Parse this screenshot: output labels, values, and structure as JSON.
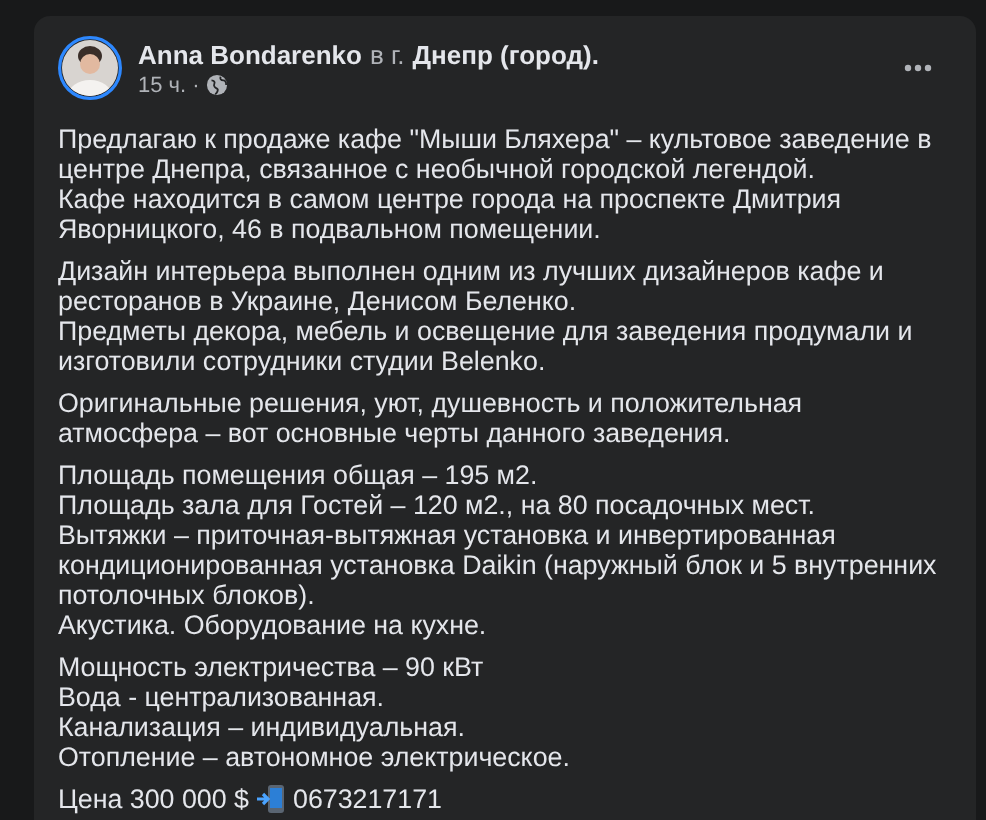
{
  "post": {
    "author": "Anna Bondarenko",
    "location_prefix": "в г.",
    "location": "Днепр (город).",
    "time": "15 ч.",
    "separator": "·",
    "paragraphs": [
      {
        "kind": "text",
        "lines": [
          "Предлагаю к продаже кафе \"Мыши Бляхера\" – культовое заведение в центре Днепра, связанное с необычной городской легендой.",
          "Кафе находится в самом центре города на проспекте Дмитрия Яворницкого, 46 в подвальном помещении."
        ]
      },
      {
        "kind": "text",
        "lines": [
          "Дизайн интерьера выполнен одним из лучших дизайнеров кафе и ресторанов в Украине, Денисом Беленко.",
          "Предметы декора, мебель и освещение для заведения продумали и изготовили сотрудники студии Belenko."
        ]
      },
      {
        "kind": "text",
        "lines": [
          "Оригинальные решения, уют, душевность и положительная атмосфера – вот основные черты данного заведения."
        ]
      },
      {
        "kind": "text",
        "lines": [
          "Площадь помещения общая – 195 м2.",
          "Площадь зала для Гостей – 120 м2., на 80 посадочных мест.",
          "Вытяжки – приточная-вытяжная установка и инвертированная кондиционированная установка Daikin (наружный блок и 5 внутренних потолочных блоков).",
          "Акустика. Оборудование на кухне."
        ]
      },
      {
        "kind": "text",
        "lines": [
          "Мощность электричества – 90 кВт",
          "Вода - централизованная.",
          "Канализация – индивидуальная.",
          "Отопление – автономное электрическое."
        ]
      },
      {
        "kind": "price",
        "before": "Цена 300 000 $",
        "after": "0673217171"
      }
    ]
  }
}
